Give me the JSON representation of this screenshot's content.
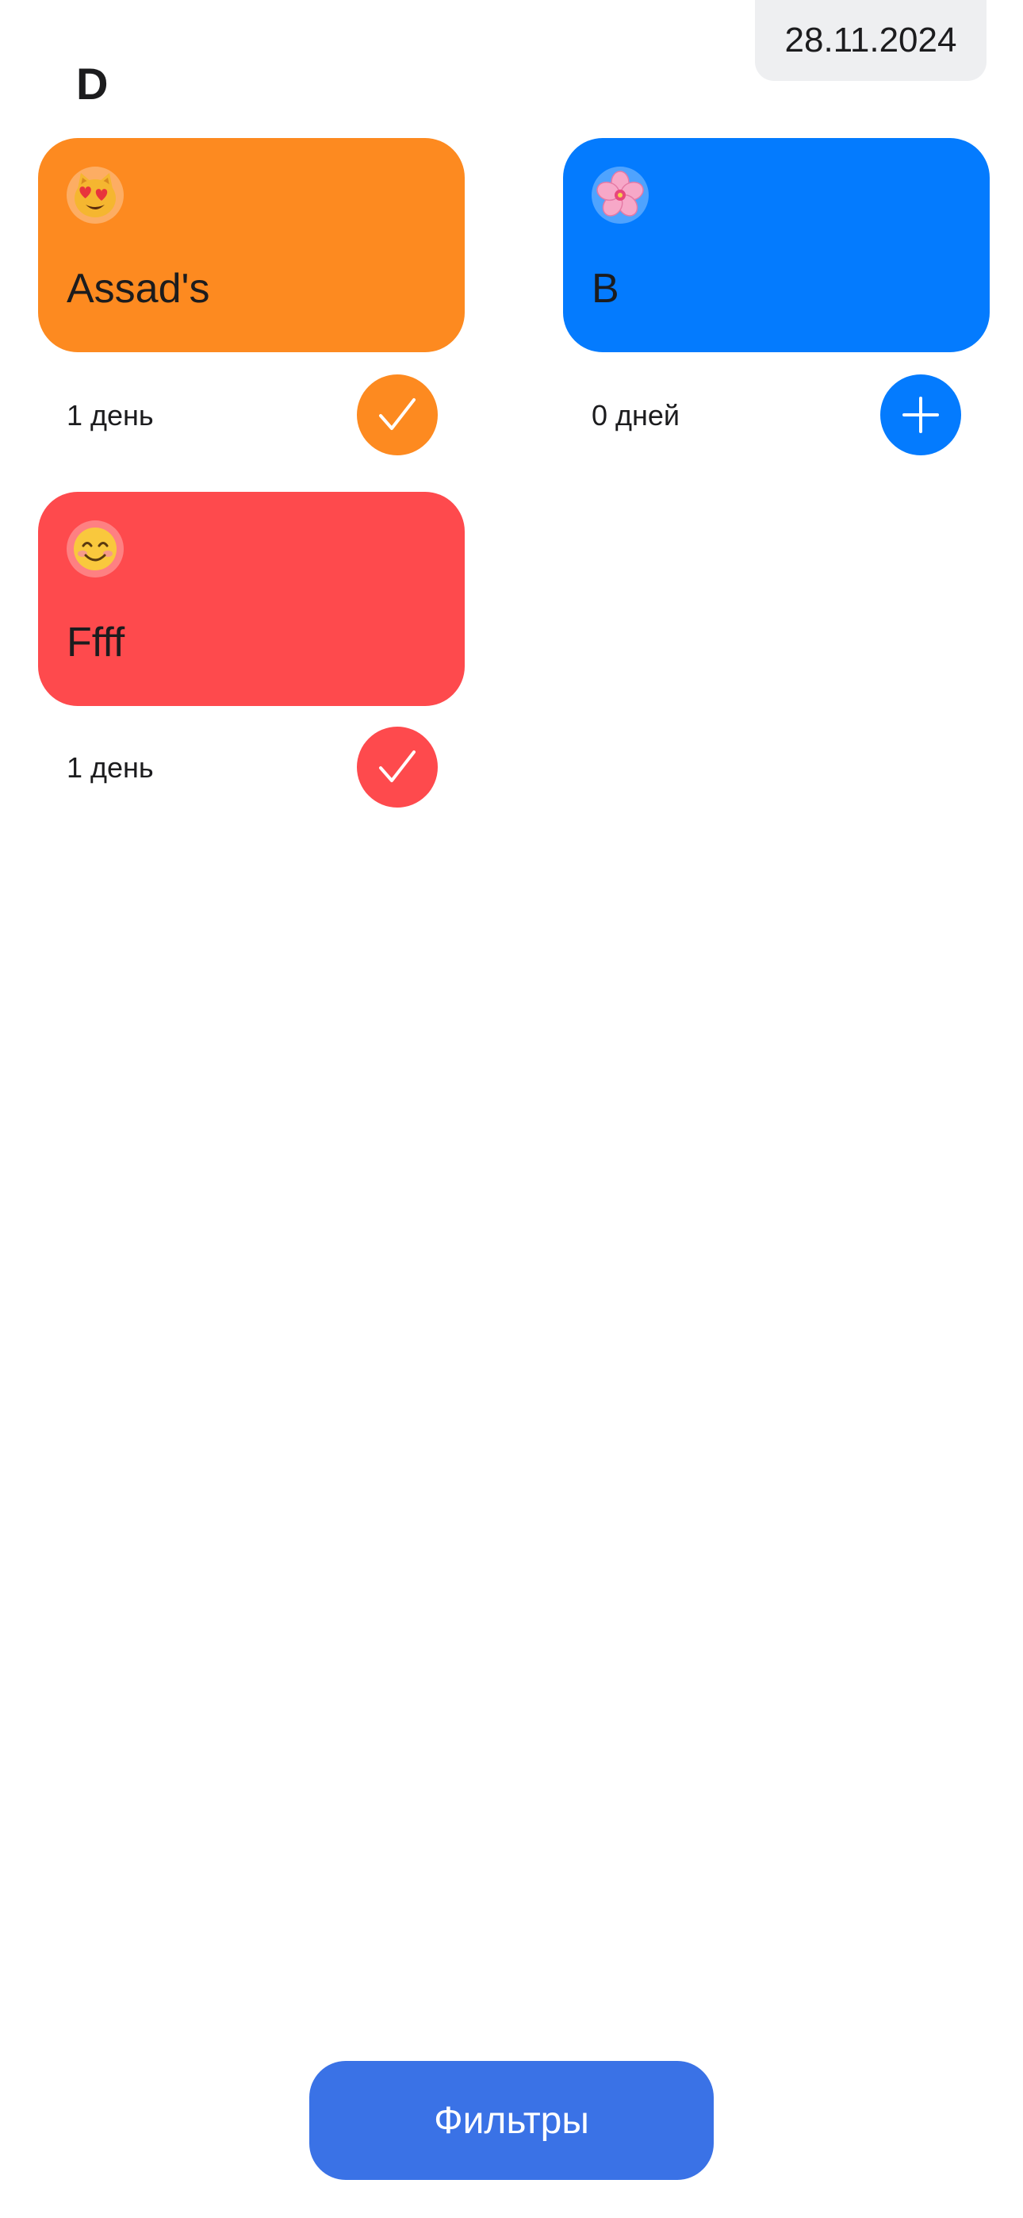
{
  "header": {
    "date": "28.11.2024",
    "title": "D"
  },
  "habits": [
    {
      "name": "Assad's",
      "emoji_icon": "smiling-cat-heart-eyes-icon",
      "color": "#fd8a20",
      "count_label": "1 день",
      "status": "done",
      "action_icon": "checkmark-icon"
    },
    {
      "name": "B",
      "emoji_icon": "cherry-blossom-icon",
      "color": "#047bfe",
      "count_label": "0 дней",
      "status": "pending",
      "action_icon": "plus-icon"
    },
    {
      "name": "Ffff",
      "emoji_icon": "smiling-face-icon",
      "color": "#fe4a4d",
      "count_label": "1 день",
      "status": "done",
      "action_icon": "checkmark-icon"
    }
  ],
  "footer": {
    "filters_label": "Фильтры",
    "button_color": "#3a72e6"
  }
}
